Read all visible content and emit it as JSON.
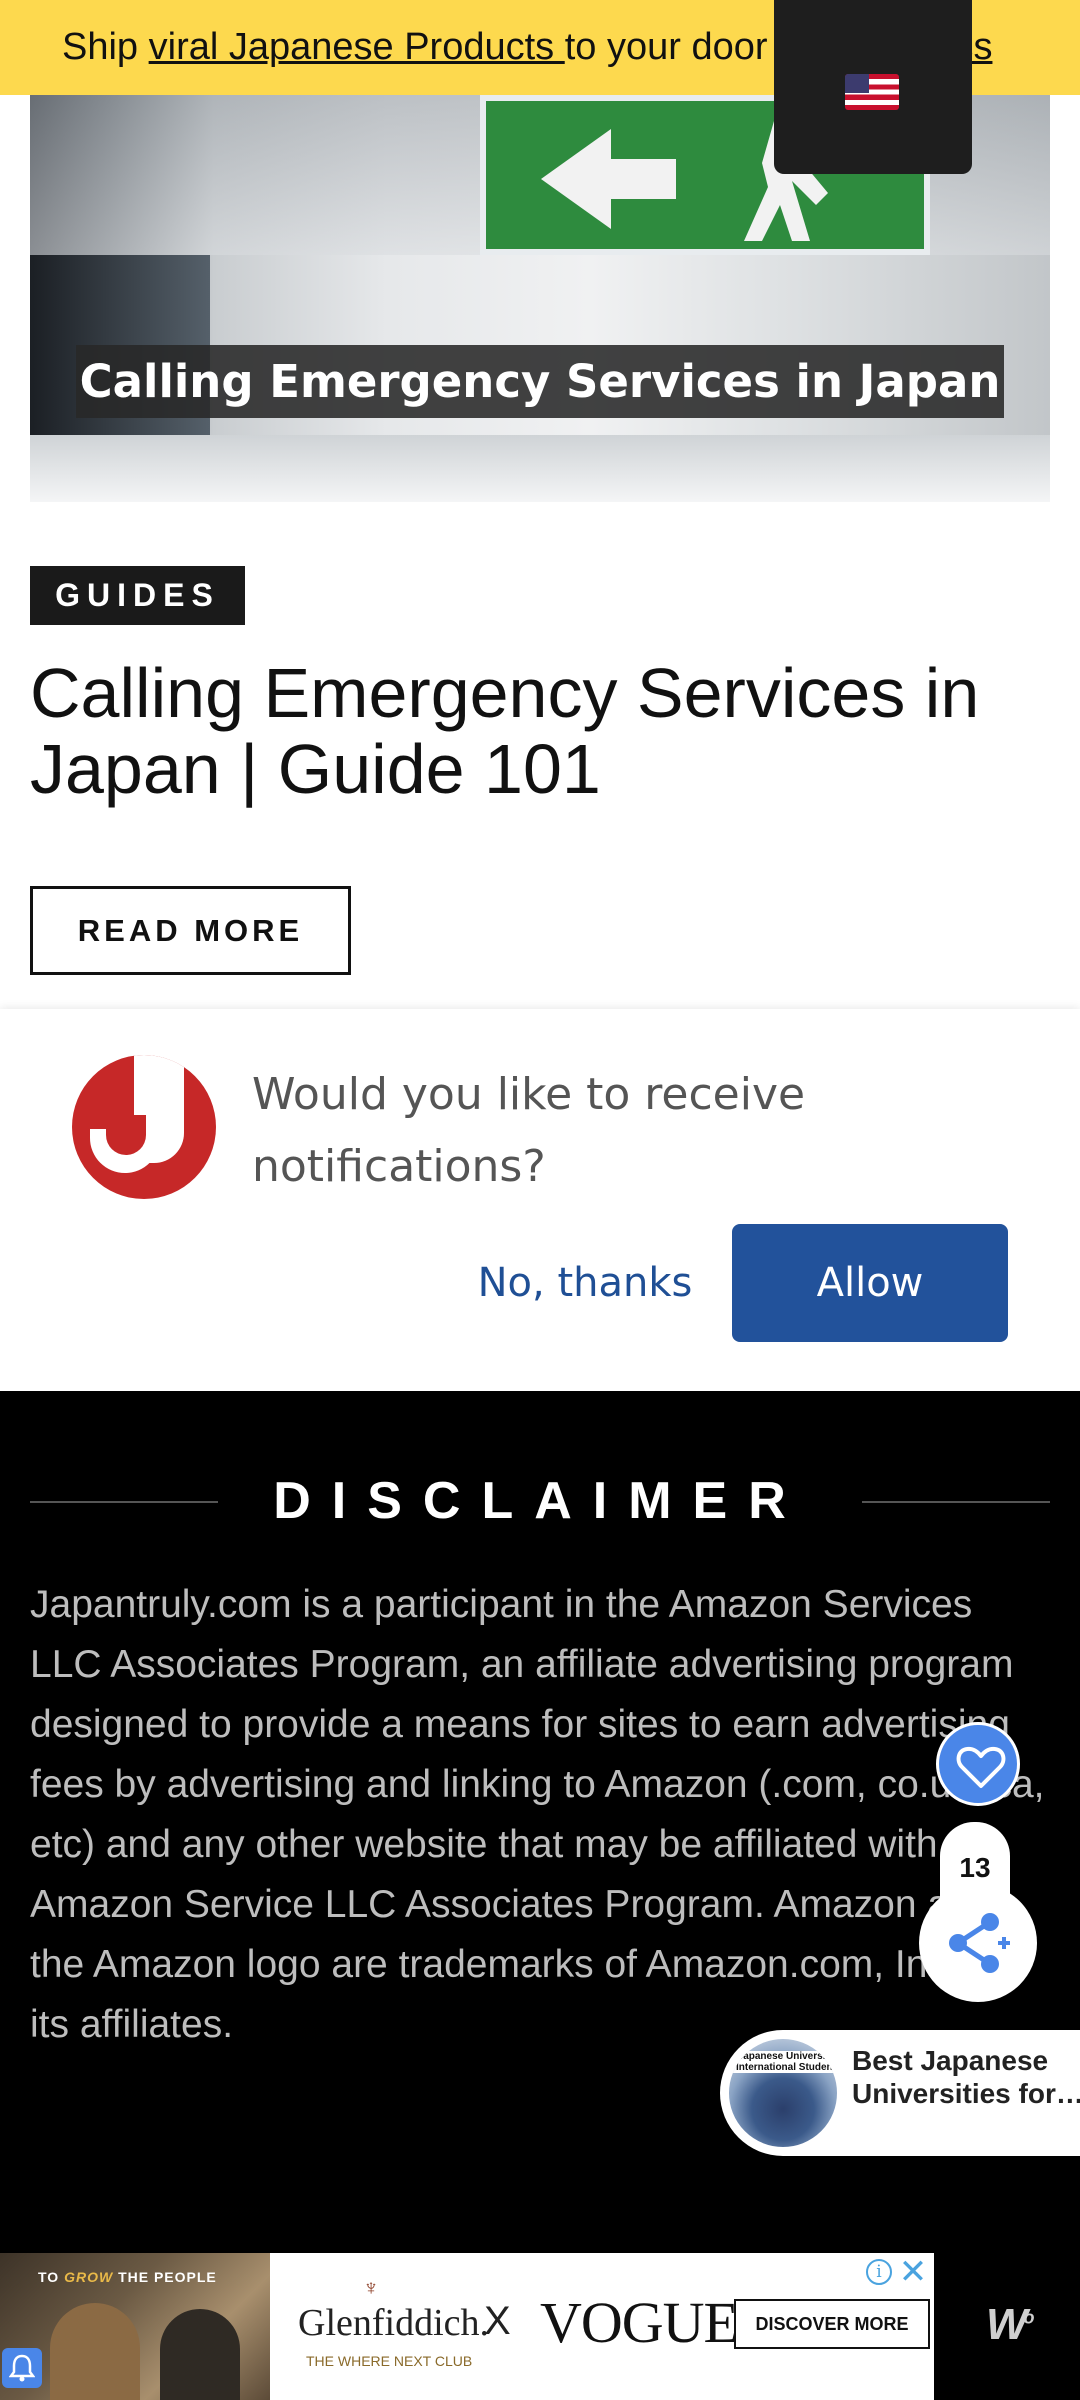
{
  "promo": {
    "prefix": "Ship ",
    "link": "viral Japanese Products ",
    "suffix": "to your door",
    "tail": "iss"
  },
  "hero": {
    "caption": "Calling Emergency Services in Japan"
  },
  "article": {
    "category": "GUIDES",
    "title": "Calling Emergency Services in Japan | Guide 101",
    "read_more": "READ MORE"
  },
  "notification": {
    "message": "Would you like to receive notifications?",
    "decline": "No, thanks",
    "accept": "Allow"
  },
  "disclaimer": {
    "heading": "DISCLAIMER",
    "body": "Japantruly.com is a participant in the Amazon Services LLC Associates Program, an affiliate advertising program designed to provide a means for sites to earn advertising fees by advertising and linking to Amazon (.com, co.uk, ca, etc) and any other website that may be affiliated with Amazon Service LLC Associates Program. Amazon and the Amazon logo are trademarks of Amazon.com, Inc. or its affiliates."
  },
  "share": {
    "count": "13"
  },
  "recommendation": {
    "title": "Best Japanese Universities for…",
    "thumb_text": "Japanese University International Student"
  },
  "ad": {
    "tagline_prefix": "TO ",
    "tagline_em": "GROW",
    "tagline_suffix": " THE PEOPLE",
    "brand": "Glenfiddich.",
    "brand_sub": "THE WHERE NEXT CLUB",
    "x": "X",
    "partner": "VOGUE",
    "cta": "DISCOVER MORE",
    "info": "i",
    "close": "✕"
  },
  "colors": {
    "promo_bg": "#fdd94e",
    "allow_bg": "#22529b",
    "link_blue": "#1f4f95",
    "brand_red": "#c62828",
    "heart_blue": "#4a86e8"
  }
}
